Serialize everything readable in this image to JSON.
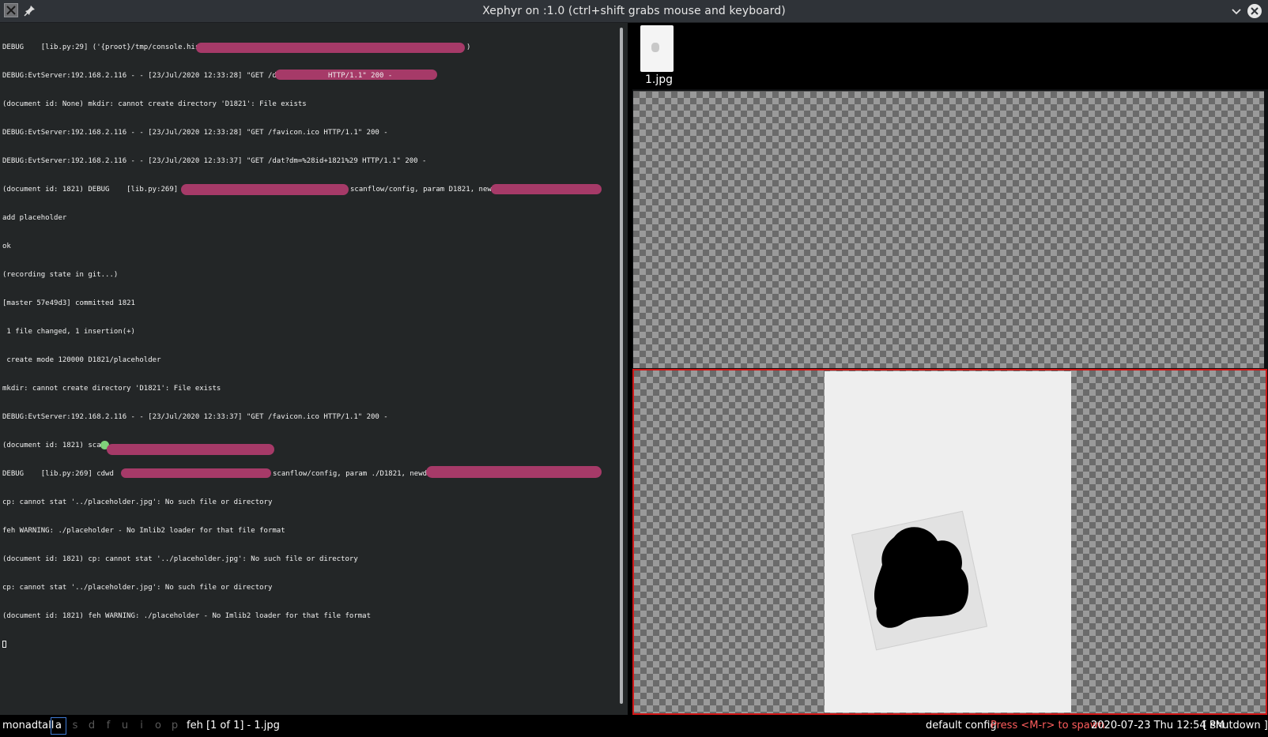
{
  "window": {
    "title": "Xephyr on :1.0 (ctrl+shift grabs mouse and keyboard)"
  },
  "terminal": {
    "lines": [
      "DEBUG    [lib.py:29] ('{proot}/tmp/console.hist', ",
      "DEBUG:EvtServer:192.168.2.116 - - [23/Jul/2020 12:33:28] \"GET /dat",
      "(document id: None) mkdir: cannot create directory 'D1821': File exists",
      "DEBUG:EvtServer:192.168.2.116 - - [23/Jul/2020 12:33:28] \"GET /favicon.ico HTTP/1.1\" 200 -",
      "DEBUG:EvtServer:192.168.2.116 - - [23/Jul/2020 12:33:37] \"GET /dat?dm=%28id+1821%29 HTTP/1.1\" 200 -",
      "(document id: 1821) DEBUG    [lib.py:269] cdwd",
      "add placeholder",
      "ok",
      "(recording state in git...)",
      "[master 57e49d3] committed 1821",
      " 1 file changed, 1 insertion(+)",
      " create mode 120000 D1821/placeholder",
      "mkdir: cannot create directory 'D1821': File exists",
      "DEBUG:EvtServer:192.168.2.116 - - [23/Jul/2020 12:33:37] \"GET /favicon.ico HTTP/1.1\" 200 -",
      "(document id: 1821) scan ",
      "DEBUG    [lib.py:269] cdwd",
      "cp: cannot stat '../placeholder.jpg': No such file or directory",
      "feh WARNING: ./placeholder - No Imlib2 loader for that file format",
      "(document id: 1821) cp: cannot stat '../placeholder.jpg': No such file or directory",
      "cp: cannot stat '../placeholder.jpg': No such file or directory",
      "(document id: 1821) feh WARNING: ./placeholder - No Imlib2 loader for that file format"
    ],
    "fragments": {
      "line0_tail": ")",
      "line1_tail": "HTTP/1.1\" 200 -",
      "line5_mid": "scanflow/config, param D1821, newdir:",
      "line15_mid": "scanflow/config, param ./D1821, newdir:"
    }
  },
  "viewer": {
    "thumbnail_label": "1.jpg"
  },
  "statusbar": {
    "layout": "monadtall",
    "groups": [
      {
        "label": "a",
        "active": true
      },
      {
        "label": "s",
        "active": false
      },
      {
        "label": "d",
        "active": false
      },
      {
        "label": "f",
        "active": false
      },
      {
        "label": "u",
        "active": false
      },
      {
        "label": "i",
        "active": false
      },
      {
        "label": "o",
        "active": false
      },
      {
        "label": "p",
        "active": false
      }
    ],
    "window_name": "feh [1 of 1] - 1.jpg",
    "config": "default config",
    "spawn_hint": "Press <M-r> to spawn",
    "clock": "2020-07-23 Thu 12:54 PM",
    "shutdown": "[ shutdown ]"
  },
  "colors": {
    "terminal_bg": "#232627",
    "redaction": "#a63a68",
    "focus_border": "#d11717",
    "spawn_hint": "#ff5d5d",
    "active_group_border": "#3f7bd4"
  }
}
